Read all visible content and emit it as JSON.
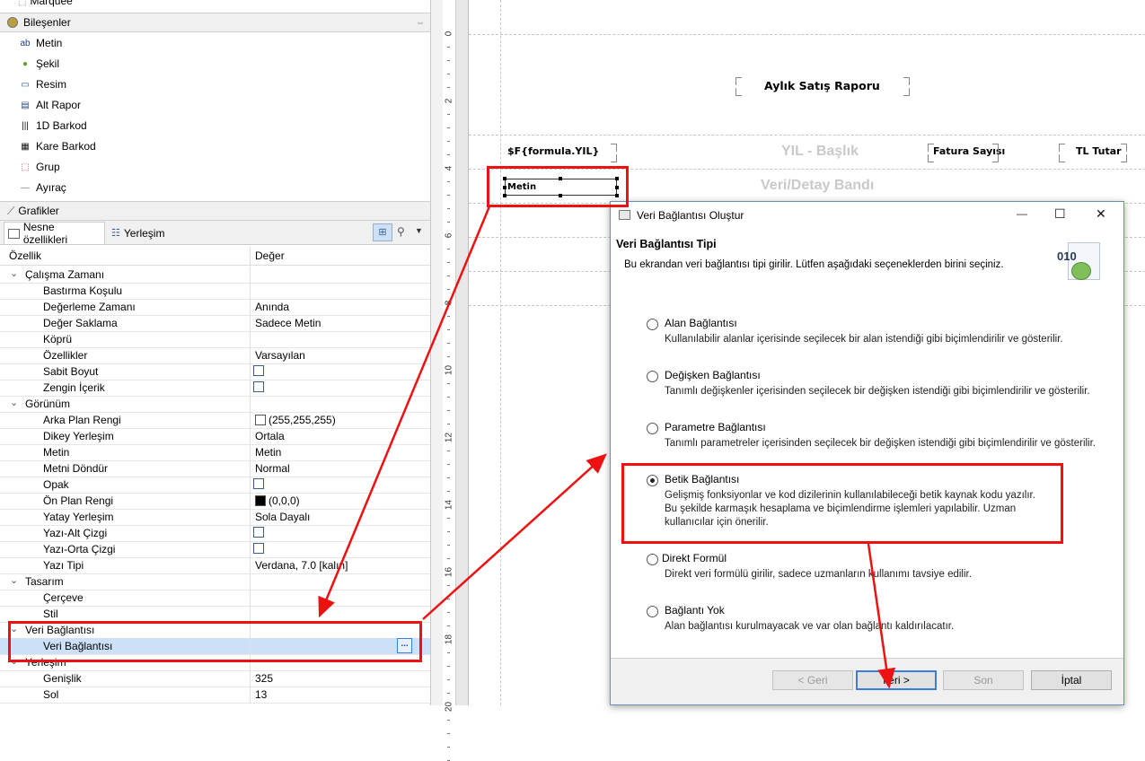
{
  "palette": {
    "top_item": "Marquee",
    "components_header": "Bileşenler",
    "items": [
      {
        "label": "Metin",
        "icon": "text-icon"
      },
      {
        "label": "Şekil",
        "icon": "shape-icon"
      },
      {
        "label": "Resim",
        "icon": "image-icon"
      },
      {
        "label": "Alt Rapor",
        "icon": "subreport-icon"
      },
      {
        "label": "1D Barkod",
        "icon": "barcode-icon"
      },
      {
        "label": "Kare Barkod",
        "icon": "qrcode-icon"
      },
      {
        "label": "Grup",
        "icon": "group-icon"
      },
      {
        "label": "Ayıraç",
        "icon": "separator-icon"
      }
    ],
    "charts_header": "Grafikler"
  },
  "tabs": {
    "properties": "Nesne özellikleri",
    "layout": "Yerleşim"
  },
  "properties": {
    "col_property": "Özellik",
    "col_value": "Değer",
    "rows": [
      {
        "type": "group",
        "name": "Çalışma Zamanı"
      },
      {
        "type": "prop",
        "name": "Bastırma Koşulu",
        "value": ""
      },
      {
        "type": "prop",
        "name": "Değerleme Zamanı",
        "value": "Anında"
      },
      {
        "type": "prop",
        "name": "Değer Saklama",
        "value": "Sadece Metin"
      },
      {
        "type": "prop",
        "name": "Köprü",
        "value": ""
      },
      {
        "type": "prop",
        "name": "Özellikler",
        "value": "Varsayılan"
      },
      {
        "type": "check",
        "name": "Sabit Boyut"
      },
      {
        "type": "check",
        "name": "Zengin İçerik"
      },
      {
        "type": "group",
        "name": "Görünüm"
      },
      {
        "type": "color",
        "name": "Arka Plan Rengi",
        "value": "(255,255,255)",
        "color": "#ffffff"
      },
      {
        "type": "prop",
        "name": "Dikey Yerleşim",
        "value": "Ortala"
      },
      {
        "type": "prop",
        "name": "Metin",
        "value": "Metin"
      },
      {
        "type": "prop",
        "name": "Metni Döndür",
        "value": "Normal"
      },
      {
        "type": "check",
        "name": "Opak"
      },
      {
        "type": "color",
        "name": "Ön Plan Rengi",
        "value": "(0,0,0)",
        "color": "#000000"
      },
      {
        "type": "prop",
        "name": "Yatay Yerleşim",
        "value": "Sola Dayalı"
      },
      {
        "type": "check",
        "name": "Yazı-Alt Çizgi"
      },
      {
        "type": "check",
        "name": "Yazı-Orta Çizgi"
      },
      {
        "type": "prop",
        "name": "Yazı Tipi",
        "value": "Verdana, 7.0 [kalın]"
      },
      {
        "type": "group",
        "name": "Tasarım"
      },
      {
        "type": "prop",
        "name": "Çerçeve",
        "value": ""
      },
      {
        "type": "prop",
        "name": "Stil",
        "value": ""
      },
      {
        "type": "group",
        "name": "Veri Bağlantısı"
      },
      {
        "type": "selected",
        "name": "Veri Bağlantısı",
        "value": "",
        "button": "..."
      },
      {
        "type": "group",
        "name": "Yerleşim"
      },
      {
        "type": "prop",
        "name": "Genişlik",
        "value": "325"
      },
      {
        "type": "prop",
        "name": "Sol",
        "value": "13"
      }
    ]
  },
  "ruler": [
    "0",
    "2",
    "4",
    "6",
    "8",
    "10",
    "12",
    "14",
    "16",
    "18",
    "20"
  ],
  "report": {
    "title": "Aylık Satış Raporu",
    "formula_field": "$F{formula.YIL}",
    "group_header_band": "YIL - Başlık",
    "invoice_count": "Fatura Sayısı",
    "tl_total": "TL Tutar",
    "detail_band": "Veri/Detay Bandı",
    "text_element": "Metin"
  },
  "dialog": {
    "title": "Veri Bağlantısı Oluştur",
    "minimize": "—",
    "maximize": "☐",
    "close": "✕",
    "heading": "Veri Bağlantısı Tipi",
    "subheading": "Bu ekrandan veri bağlantısı tipi girilir. Lütfen aşağıdaki seçeneklerden birini seçiniz.",
    "icon_text": "010",
    "options": [
      {
        "label": "Alan Bağlantısı",
        "desc": "Kullanılabilir alanlar içerisinde seçilecek bir alan istendiği gibi biçimlendirilir ve gösterilir.",
        "selected": false
      },
      {
        "label": "Değişken Bağlantısı",
        "desc": "Tanımlı değişkenler içerisinden seçilecek bir değişken istendiği gibi biçimlendirilir ve gösterilir.",
        "selected": false
      },
      {
        "label": "Parametre Bağlantısı",
        "desc": "Tanımlı parametreler içerisinden seçilecek bir değişken istendiği gibi biçimlendirilir ve gösterilir.",
        "selected": false
      },
      {
        "label": "Betik Bağlantısı",
        "desc1": "Gelişmiş fonksiyonlar ve kod dizilerinin kullanılabileceği betik kaynak kodu yazılır.",
        "desc2": "Bu şekilde karmaşık hesaplama ve biçimlendirme işlemleri yapılabilir. Uzman",
        "desc3": "kullanıcılar için önerilir.",
        "selected": true
      },
      {
        "label": "Direkt Formül",
        "desc": "Direkt veri formülü girilir, sadece uzmanların kullanımı tavsiye edilir.",
        "selected": false
      },
      {
        "label": "Bağlantı Yok",
        "desc": "Alan bağlantısı kurulmayacak ve var olan bağlantı kaldırılacatır.",
        "selected": false
      }
    ],
    "buttons": {
      "back": "< Geri",
      "next": "İleri >",
      "finish": "Son",
      "cancel": "İptal"
    }
  },
  "colors": {
    "annotation": "#e11111",
    "accent": "#3b7ddd"
  }
}
